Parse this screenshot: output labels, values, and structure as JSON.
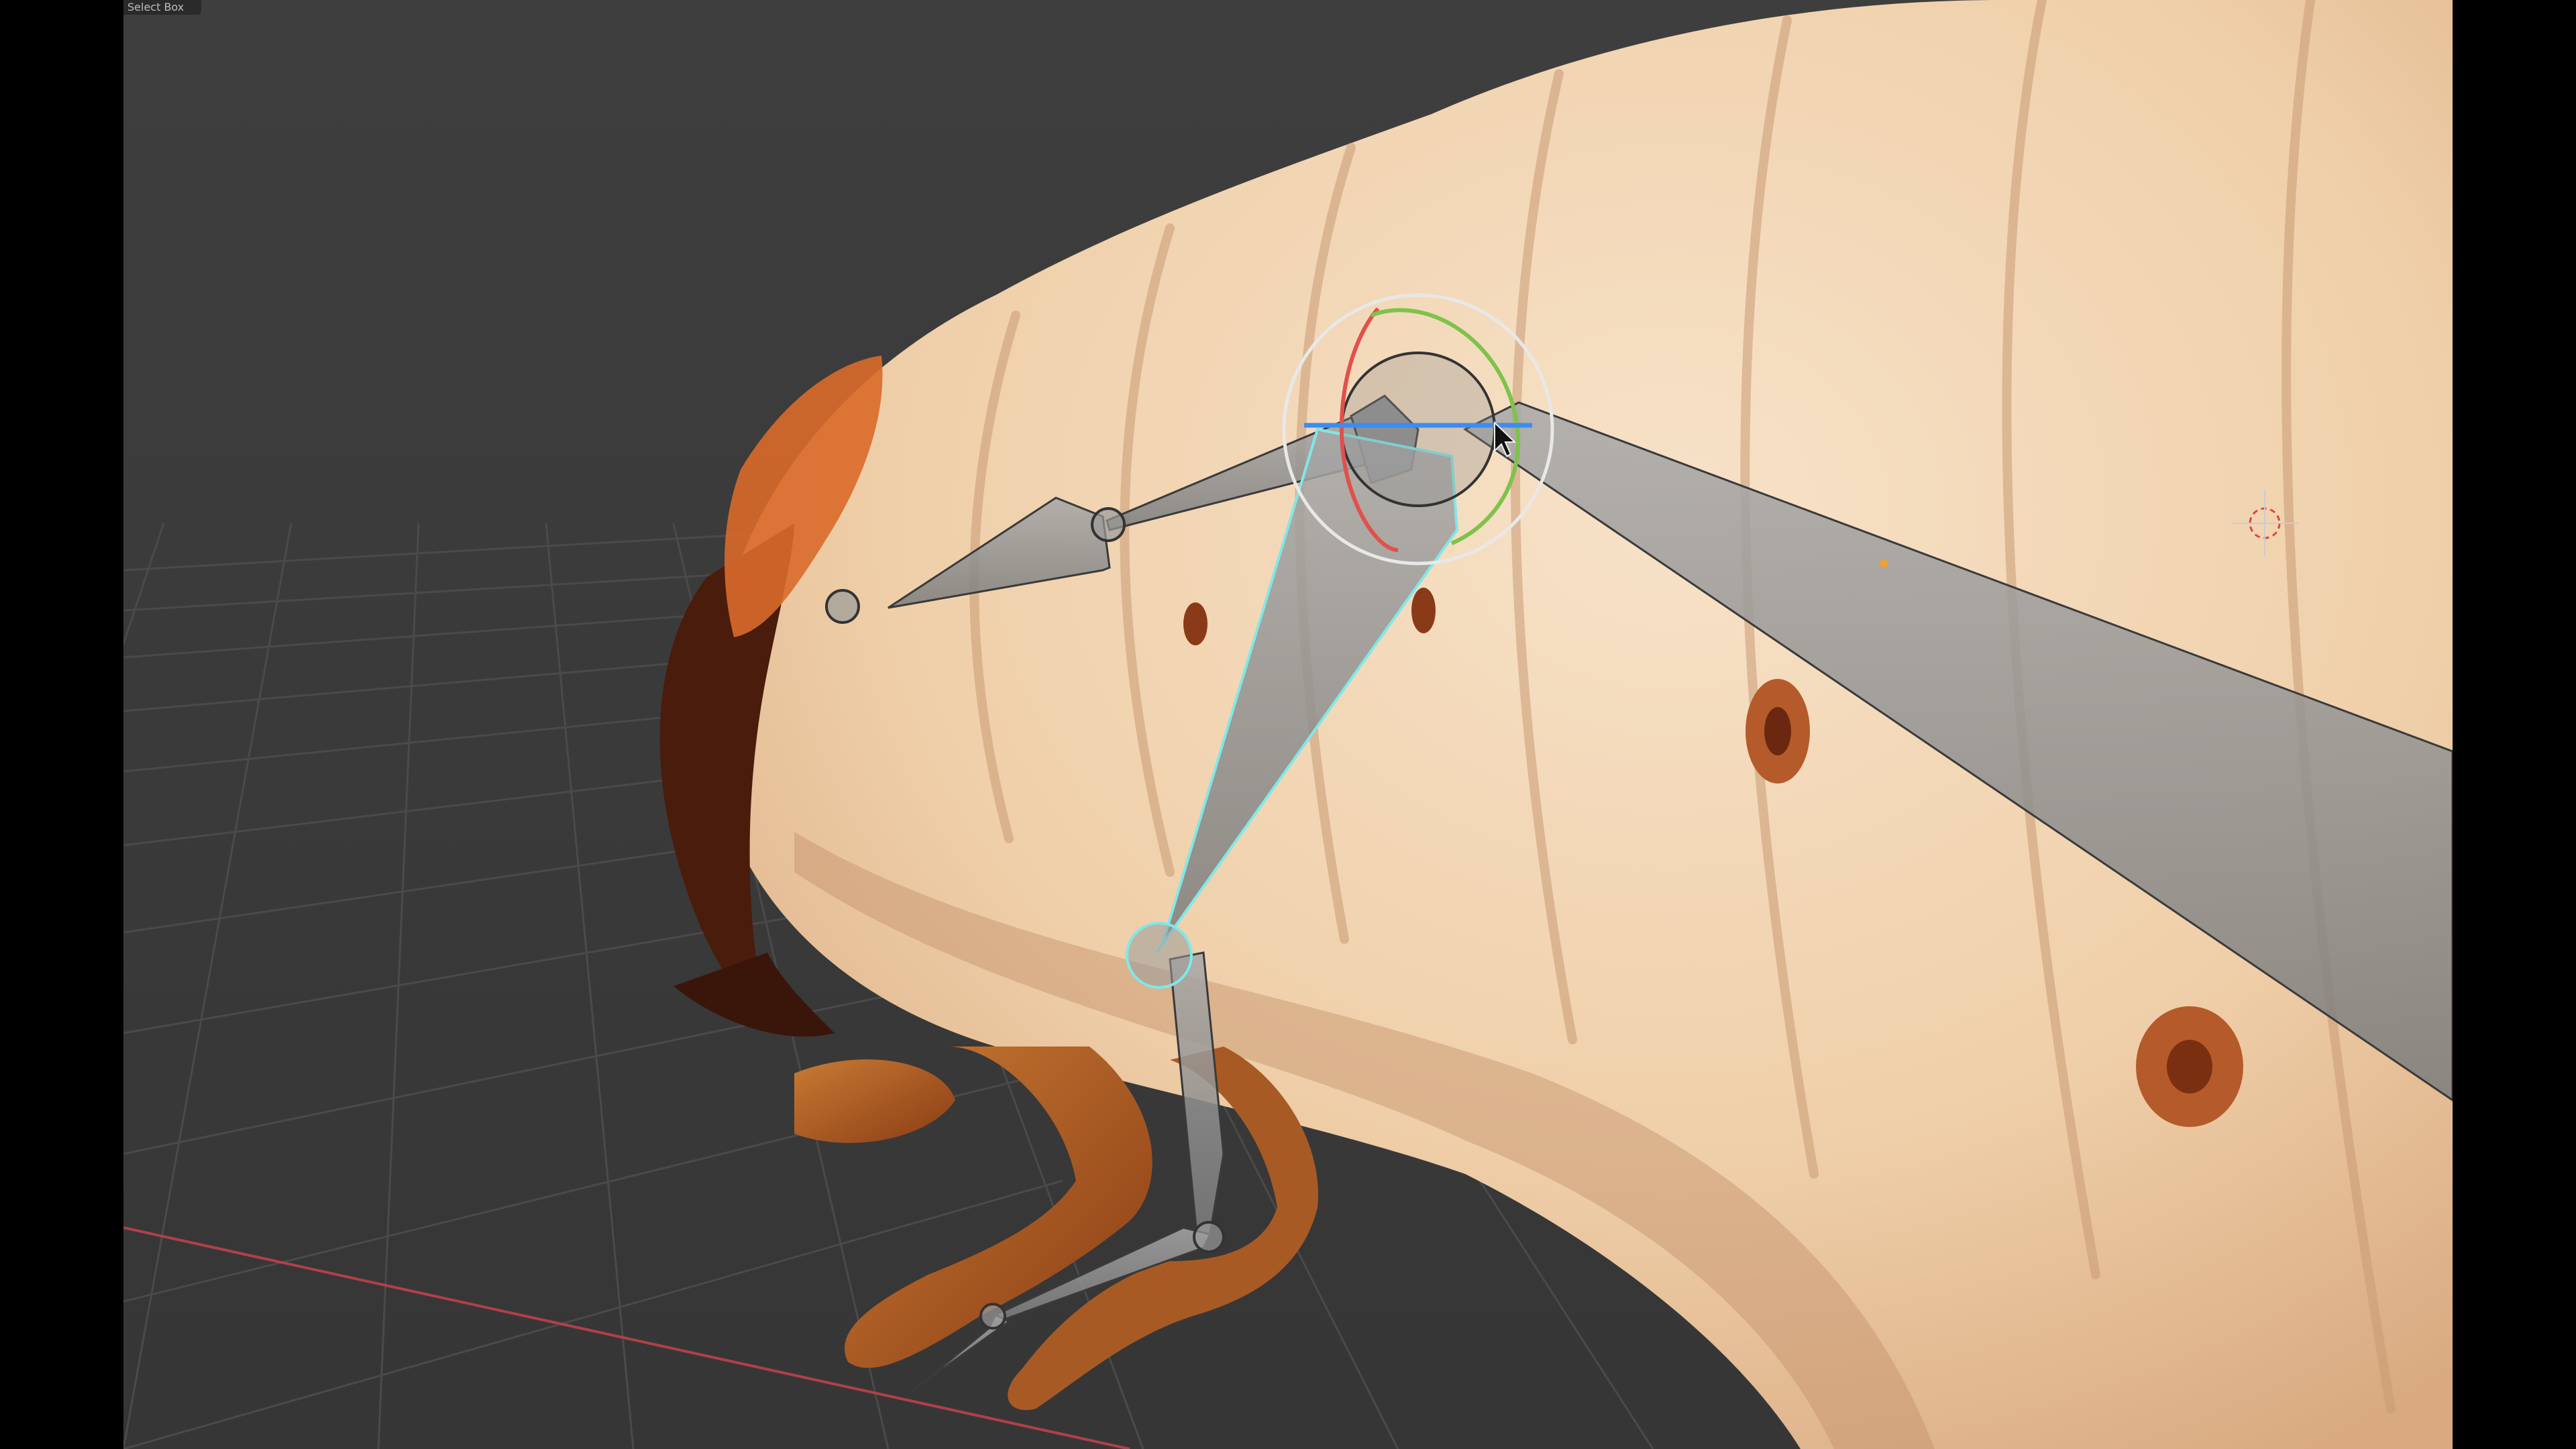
{
  "viewport": {
    "active_tool_label": "Select Box",
    "background_color": "#3b3b3b",
    "grid_color": "#4a4a4a",
    "x_axis_color": "#b0404a"
  },
  "scene": {
    "subject": "larva-mesh",
    "skin_color": "#f0d2b0",
    "skin_shadow_color": "#c99a74",
    "head_color": "#5a2410",
    "leg_color": "#b86a2a",
    "bone_color": "#9a9a9a",
    "selected_bone_outline": "#7fe8e8"
  },
  "gizmo": {
    "type": "rotate",
    "x_axis_color": "#e2504b",
    "y_axis_color": "#7ec24a",
    "z_axis_color": "#3d8cf0",
    "outer_ring_color": "#e8e8e8"
  },
  "icons": [
    "cursor-arrow-icon",
    "3d-cursor-icon",
    "object-origin-icon"
  ]
}
